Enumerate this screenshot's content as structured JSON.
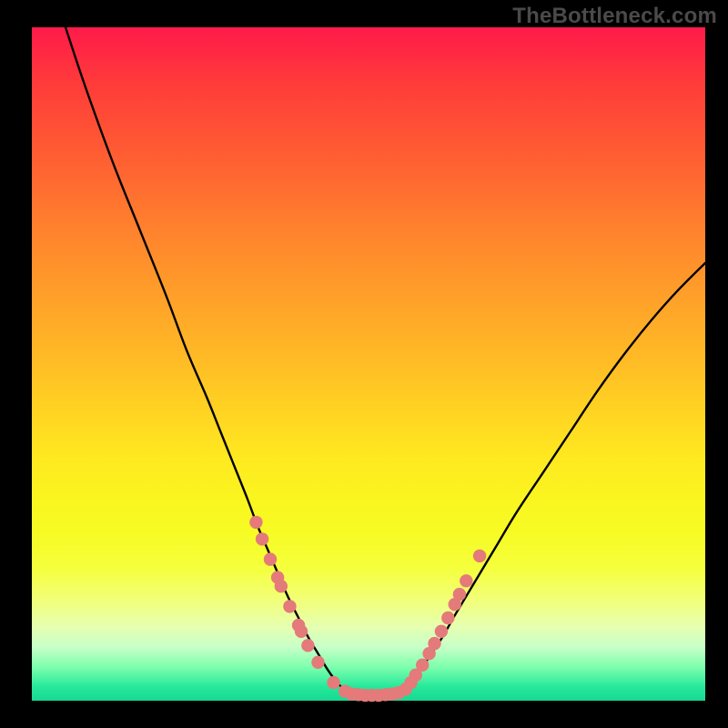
{
  "watermark": "TheBottleneck.com",
  "colors": {
    "curve": "#000000",
    "dot": "#e47a7a",
    "background_top": "#ff1a4a",
    "background_bottom": "#18d892",
    "frame": "#000000"
  },
  "chart_data": {
    "type": "line",
    "title": "",
    "xlabel": "",
    "ylabel": "",
    "xlim": [
      0,
      100
    ],
    "ylim": [
      0,
      100
    ],
    "series": [
      {
        "name": "left-branch",
        "x": [
          5,
          8,
          12,
          16,
          20,
          23,
          26,
          28,
          30,
          32,
          33.5,
          35,
          36.5,
          38,
          39.5,
          41,
          42.5,
          44,
          45.5,
          47
        ],
        "y": [
          100,
          91,
          80,
          70,
          60,
          52,
          45,
          40,
          35,
          30,
          26,
          22.5,
          19,
          15.5,
          12.5,
          9.5,
          7,
          4.5,
          2.5,
          1.2
        ]
      },
      {
        "name": "valley-floor",
        "x": [
          47,
          49,
          51,
          53,
          55
        ],
        "y": [
          1.2,
          0.8,
          0.7,
          0.8,
          1.2
        ]
      },
      {
        "name": "right-branch",
        "x": [
          55,
          57,
          59,
          61,
          63,
          66,
          69,
          72,
          76,
          80,
          84,
          88,
          92,
          96,
          100
        ],
        "y": [
          1.2,
          3.5,
          6.5,
          9.5,
          13,
          18,
          23,
          28,
          34,
          40,
          46,
          51.5,
          56.5,
          61,
          65
        ]
      }
    ],
    "dots": [
      {
        "x": 33.3,
        "y": 26.5
      },
      {
        "x": 34.2,
        "y": 24.0
      },
      {
        "x": 35.4,
        "y": 21.0
      },
      {
        "x": 36.5,
        "y": 18.3
      },
      {
        "x": 37.0,
        "y": 17.0
      },
      {
        "x": 38.3,
        "y": 14.0
      },
      {
        "x": 39.6,
        "y": 11.2
      },
      {
        "x": 40.0,
        "y": 10.3
      },
      {
        "x": 41.0,
        "y": 8.2
      },
      {
        "x": 42.5,
        "y": 5.7
      },
      {
        "x": 44.8,
        "y": 2.7
      },
      {
        "x": 46.5,
        "y": 1.4
      },
      {
        "x": 47.5,
        "y": 1.0
      },
      {
        "x": 48.5,
        "y": 0.9
      },
      {
        "x": 49.5,
        "y": 0.8
      },
      {
        "x": 50.5,
        "y": 0.8
      },
      {
        "x": 51.5,
        "y": 0.8
      },
      {
        "x": 52.5,
        "y": 0.9
      },
      {
        "x": 53.5,
        "y": 1.0
      },
      {
        "x": 54.5,
        "y": 1.2
      },
      {
        "x": 55.5,
        "y": 1.7
      },
      {
        "x": 56.3,
        "y": 2.7
      },
      {
        "x": 57.0,
        "y": 3.8
      },
      {
        "x": 58.0,
        "y": 5.3
      },
      {
        "x": 59.0,
        "y": 7.0
      },
      {
        "x": 59.8,
        "y": 8.5
      },
      {
        "x": 60.8,
        "y": 10.3
      },
      {
        "x": 61.8,
        "y": 12.3
      },
      {
        "x": 62.8,
        "y": 14.3
      },
      {
        "x": 63.5,
        "y": 15.8
      },
      {
        "x": 64.5,
        "y": 17.8
      },
      {
        "x": 66.5,
        "y": 21.5
      }
    ]
  }
}
